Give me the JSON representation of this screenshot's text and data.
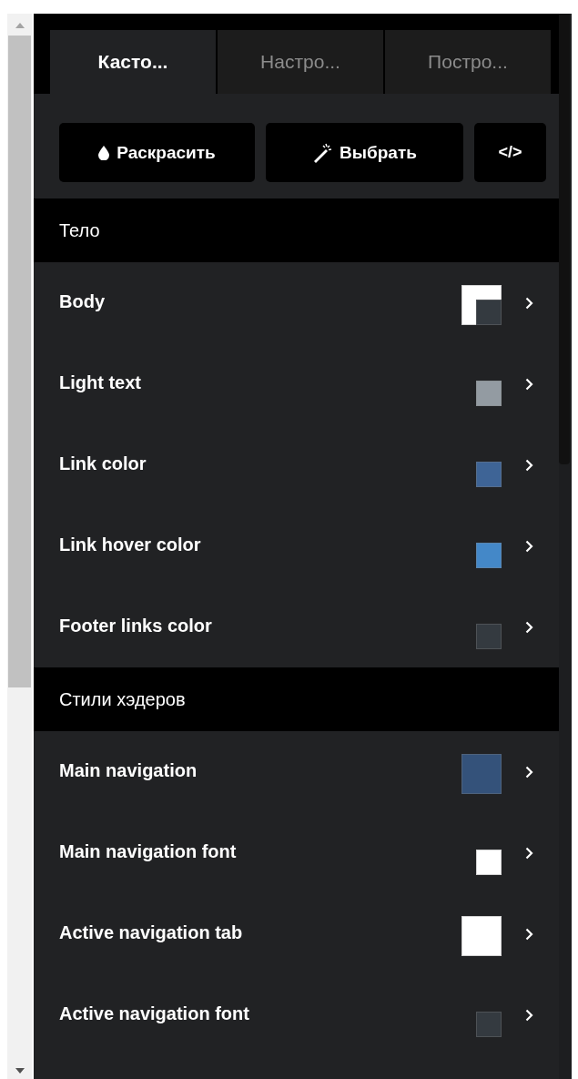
{
  "tabs": [
    {
      "label": "Касто...",
      "selected": true
    },
    {
      "label": "Настро...",
      "selected": false
    },
    {
      "label": "Постро...",
      "selected": false
    }
  ],
  "buttons": [
    {
      "kind": "drop",
      "label": "Раскрасить"
    },
    {
      "kind": "wand",
      "label": "Выбрать"
    },
    {
      "kind": "code",
      "label": "</>"
    }
  ],
  "sections": [
    {
      "title": "Тело",
      "items": [
        {
          "label": "Body",
          "swatches": [
            {
              "kind": "background",
              "color": "#ffffff"
            },
            {
              "kind": "text",
              "color": "#343a40"
            }
          ]
        },
        {
          "label": "Light text",
          "swatches": [
            {
              "kind": "text",
              "color": "#939ba2"
            }
          ]
        },
        {
          "label": "Link color",
          "swatches": [
            {
              "kind": "text",
              "color": "#3e6496"
            }
          ]
        },
        {
          "label": "Link hover color",
          "swatches": [
            {
              "kind": "text",
              "color": "#4488c8"
            }
          ]
        },
        {
          "label": "Footer links color",
          "swatches": [
            {
              "kind": "text",
              "color": "#343a40"
            }
          ]
        }
      ]
    },
    {
      "title": "Стили хэдеров",
      "items": [
        {
          "label": "Main navigation",
          "swatches": [
            {
              "kind": "background",
              "color": "#34527a"
            }
          ]
        },
        {
          "label": "Main navigation font",
          "swatches": [
            {
              "kind": "text",
              "color": "#ffffff"
            }
          ]
        },
        {
          "label": "Active navigation tab",
          "swatches": [
            {
              "kind": "background",
              "color": "#ffffff"
            }
          ]
        },
        {
          "label": "Active navigation font",
          "swatches": [
            {
              "kind": "text",
              "color": "#343a40"
            }
          ]
        }
      ]
    }
  ]
}
